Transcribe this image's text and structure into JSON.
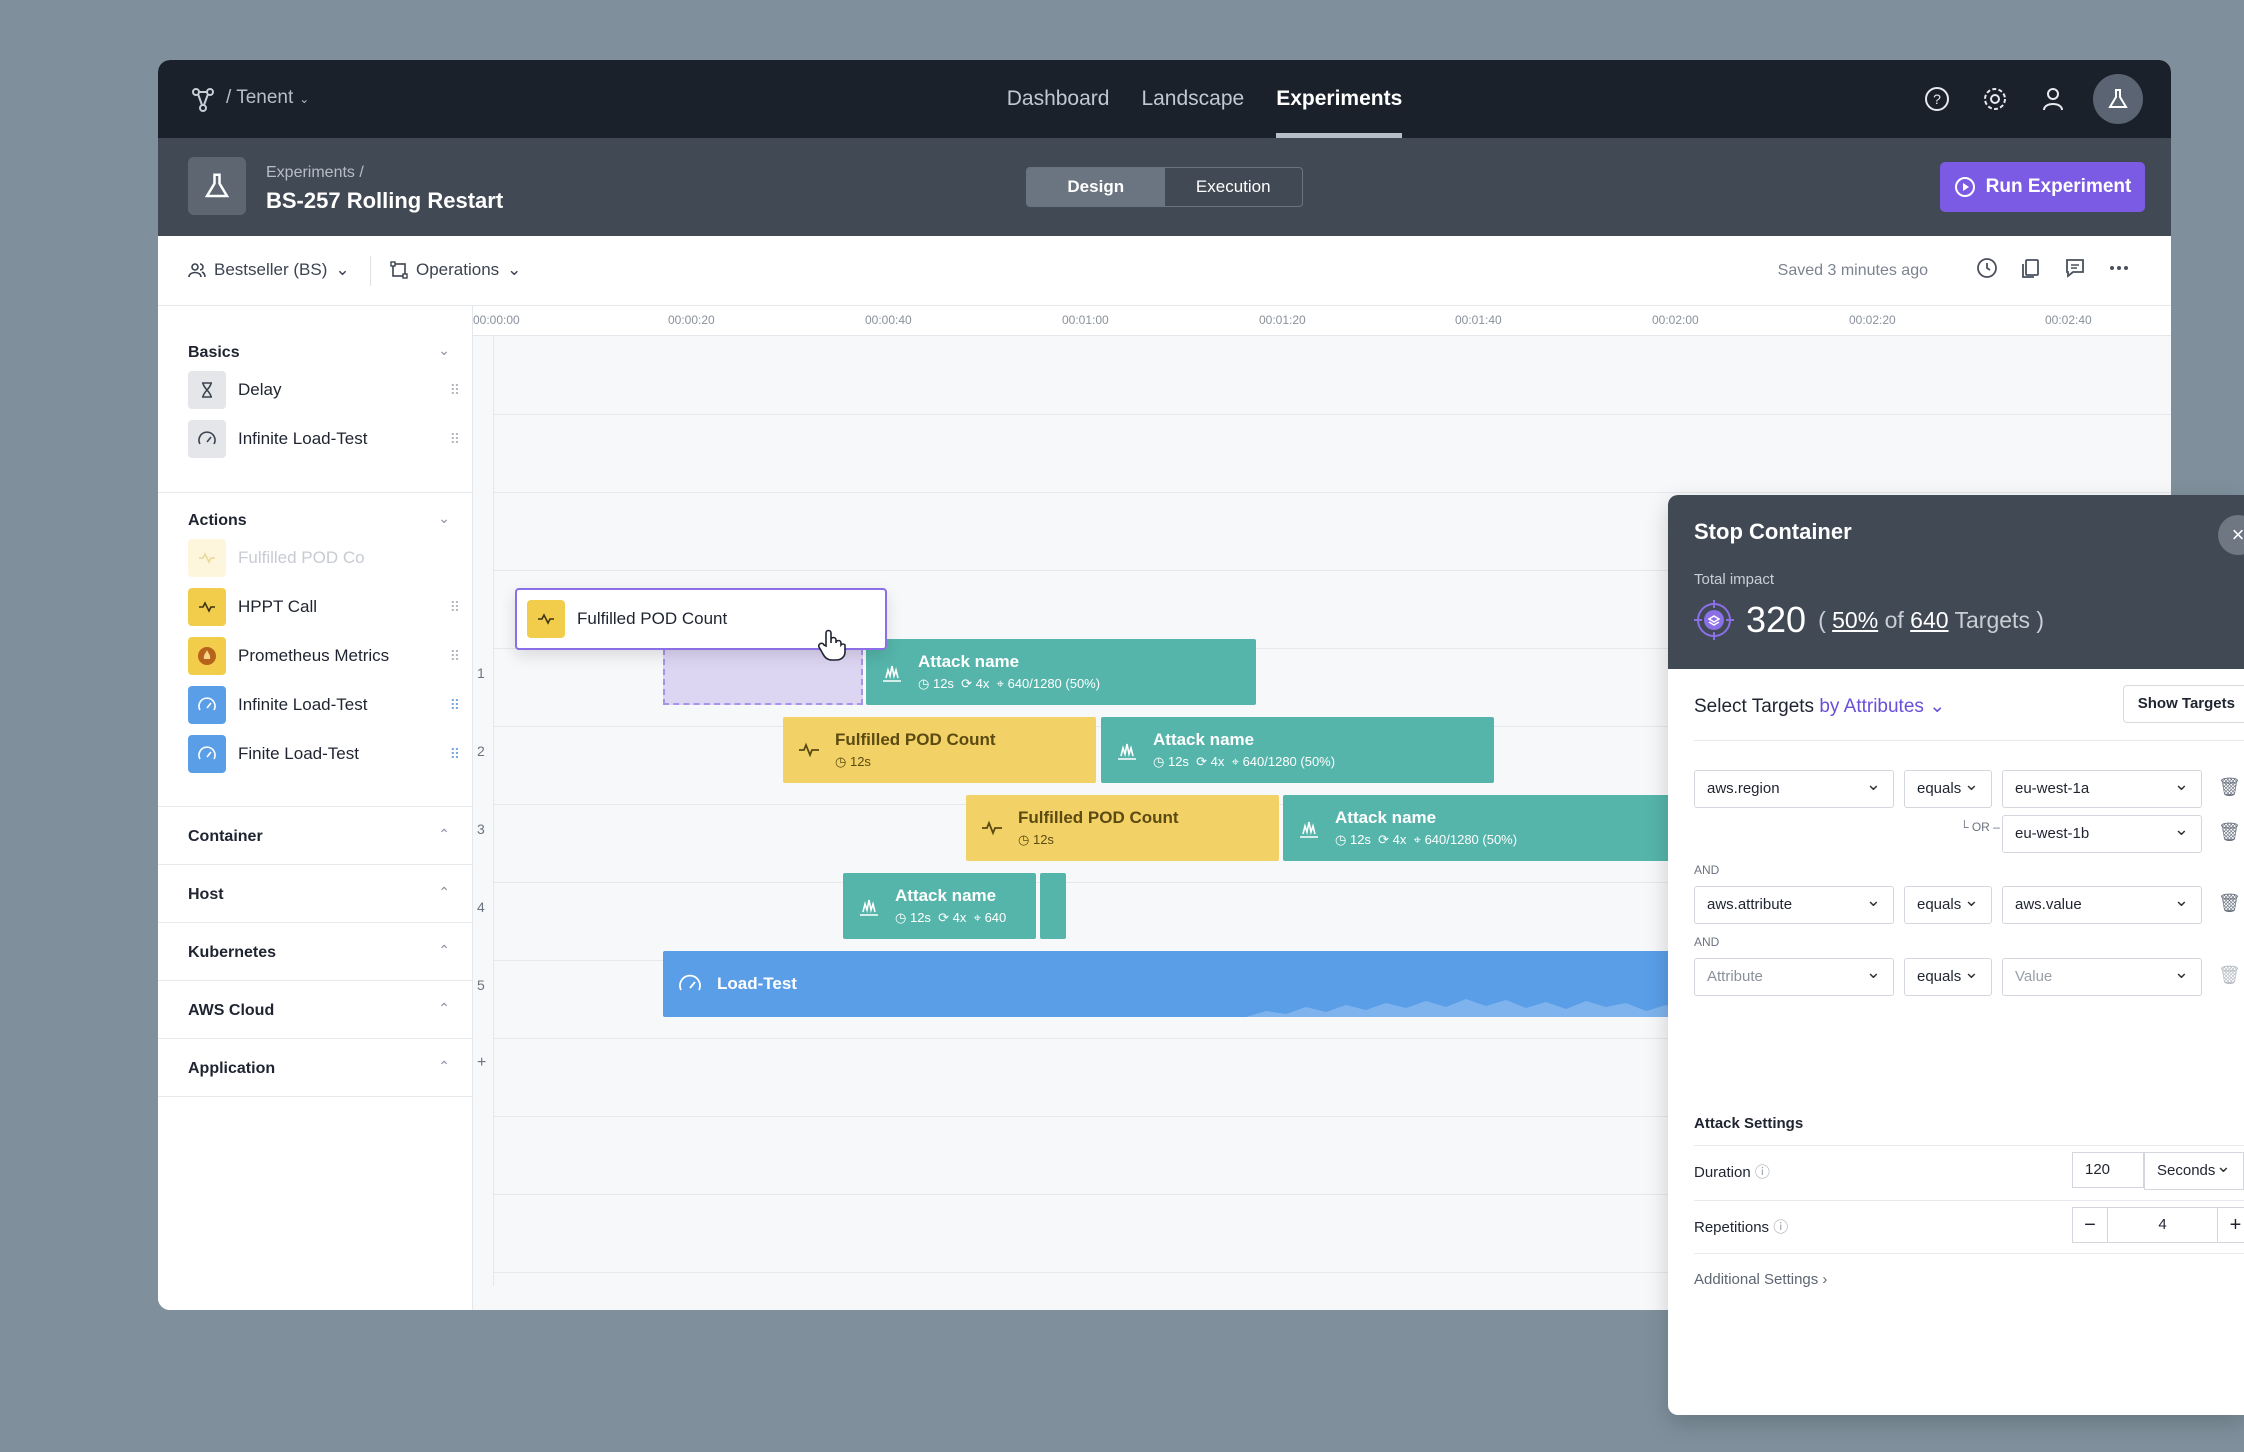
{
  "nav": {
    "tenant": "/ Tenent",
    "tabs": [
      "Dashboard",
      "Landscape",
      "Experiments"
    ],
    "active_tab": "Experiments",
    "icons": [
      "help-icon",
      "gear-icon",
      "user-icon",
      "flask-icon"
    ]
  },
  "header": {
    "breadcrumb": "Experiments /",
    "title": "BS-257  Rolling Restart",
    "segments": [
      "Design",
      "Execution"
    ],
    "active_segment": "Design",
    "run_label": "Run Experiment",
    "accent": "#7b5be3"
  },
  "toolbar": {
    "team": "Bestseller (BS)",
    "environment": "Operations",
    "saved": "Saved 3 minutes ago"
  },
  "sidebar": {
    "sections": [
      "Basics",
      "Actions",
      "Container",
      "Host",
      "Kubernetes",
      "AWS Cloud",
      "Application"
    ],
    "basics": [
      "Delay",
      "Infinite Load-Test"
    ],
    "actions": [
      "Fulfilled POD Co",
      "HPPT Call",
      "Prometheus Metrics",
      "Infinite Load-Test",
      "Finite Load-Test"
    ]
  },
  "drag": {
    "label": "Fulfilled POD Count"
  },
  "timeline": {
    "ticks": [
      "00:00:00",
      "00:00:20",
      "00:00:40",
      "00:01:00",
      "00:01:20",
      "00:01:40",
      "00:02:00",
      "00:02:20",
      "00:02:40"
    ],
    "lanes": [
      "1",
      "2",
      "3",
      "4",
      "5",
      "+"
    ],
    "blocks": {
      "attack_name": "Attack name",
      "duration": "12s",
      "reps": "4x",
      "targets": "640/1280 (50%)",
      "targets_cut": "640",
      "pod_count": "Fulfilled POD Count",
      "load_test": "Load-Test"
    },
    "colors": {
      "attack": "#55b5aa",
      "check": "#f2d266",
      "load": "#5a9ee8"
    }
  },
  "panel": {
    "title": "Stop Container",
    "impact_label": "Total impact",
    "impact_count": "320",
    "impact_pct": "50%",
    "impact_of": "of",
    "impact_total": "640",
    "impact_unit": "Targets )",
    "open_paren": "(",
    "select_label": "Select Targets",
    "select_mode": "by Attributes",
    "show_targets": "Show Targets",
    "rules": {
      "attr1": "aws.region",
      "op1": "equals",
      "val1": "eu-west-1a",
      "or_label": "OR",
      "val1b": "eu-west-1b",
      "and_label": "AND",
      "attr2": "aws.attribute",
      "op2": "equals",
      "val2": "aws.value",
      "attr3": "Attribute",
      "op3": "equals",
      "val3": "Value"
    },
    "settings_title": "Attack Settings",
    "duration_label": "Duration",
    "duration_value": "120",
    "duration_unit": "Seconds",
    "repetitions_label": "Repetitions",
    "repetitions_value": "4",
    "additional": "Additional Settings"
  }
}
